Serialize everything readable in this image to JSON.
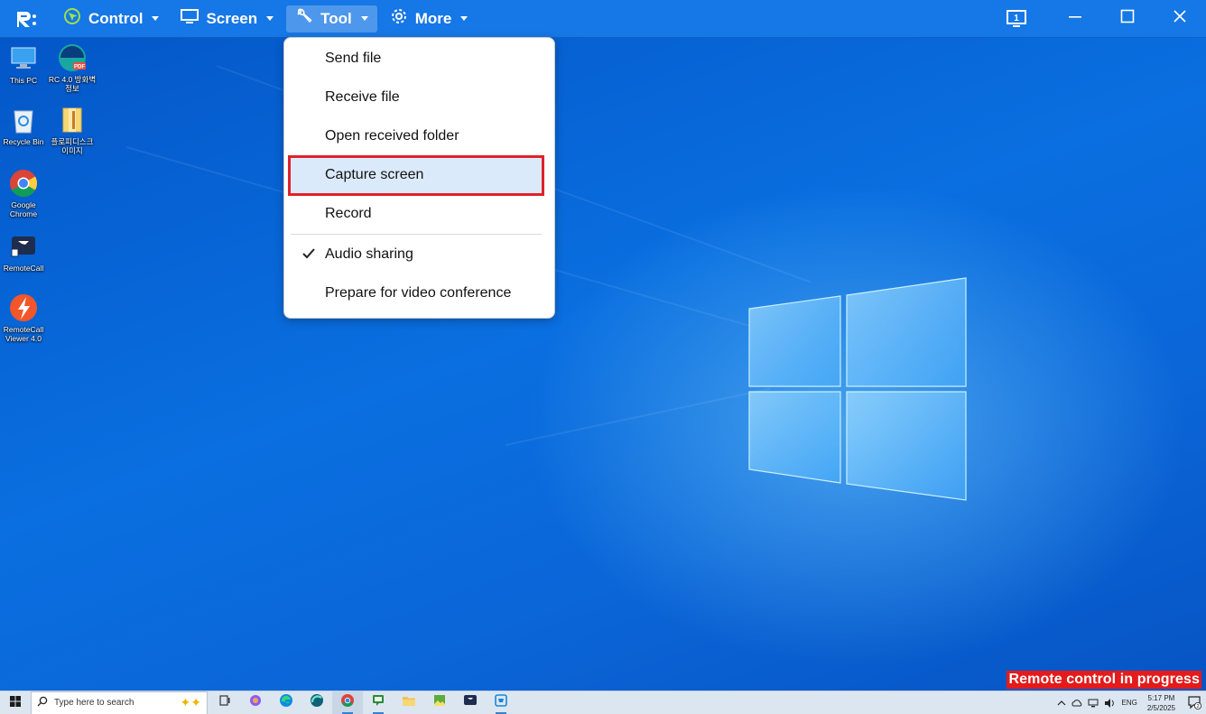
{
  "toolbar": {
    "menus": [
      {
        "label": "Control",
        "icon": "control-icon"
      },
      {
        "label": "Screen",
        "icon": "monitor-icon"
      },
      {
        "label": "Tool",
        "icon": "wrench-icon"
      },
      {
        "label": "More",
        "icon": "gear-icon"
      }
    ],
    "active_menu": "Tool",
    "monitor_badge": "1",
    "accent_color": "#1677e6"
  },
  "tool_menu": {
    "items": [
      {
        "label": "Send file",
        "checked": false
      },
      {
        "label": "Receive file",
        "checked": false
      },
      {
        "label": "Open received folder",
        "checked": false
      },
      {
        "label": "Capture screen",
        "checked": false,
        "highlighted": true
      },
      {
        "label": "Record",
        "checked": false
      },
      {
        "label": "Audio sharing",
        "checked": true
      },
      {
        "label": "Prepare for video conference",
        "checked": false
      }
    ]
  },
  "desktop": {
    "icons": [
      {
        "label": "This PC",
        "icon": "this-pc-icon"
      },
      {
        "label": "RC 4.0 방화벽 정보",
        "icon": "pdf-icon"
      },
      {
        "label": "Recycle Bin",
        "icon": "recycle-bin-icon"
      },
      {
        "label": "플로피디스크 이미지",
        "icon": "folder-icon"
      },
      {
        "label": "Google Chrome",
        "icon": "chrome-icon"
      },
      {
        "label": "RemoteCall",
        "icon": "remotecall-icon"
      },
      {
        "label": "RemoteCall Viewer 4.0",
        "icon": "remotecall-viewer-icon"
      }
    ],
    "status_banner": "Remote control in progress",
    "status_color": "#e41b1b"
  },
  "taskbar": {
    "search_placeholder": "Type here to search",
    "apps": [
      "task-view-icon",
      "copilot-icon",
      "edge-icon",
      "edge-dev-icon",
      "chrome-icon",
      "chat-icon",
      "file-explorer-icon",
      "photos-icon",
      "remotecall-icon",
      "store-icon"
    ],
    "tray": {
      "language": "ENG",
      "time": "5:17 PM",
      "date": "2/5/2025",
      "notification_count": "2"
    }
  }
}
